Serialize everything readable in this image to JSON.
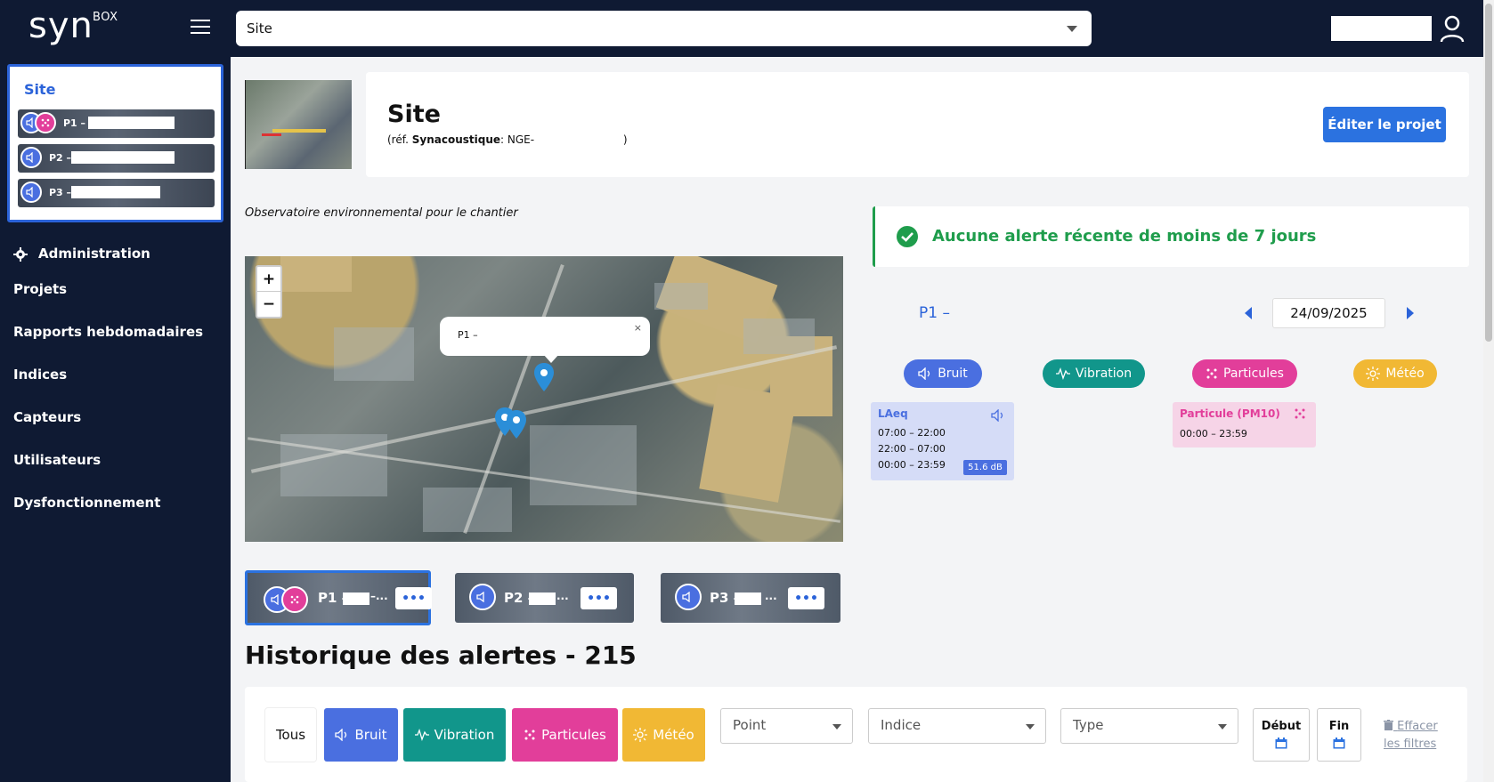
{
  "app": {
    "logo": "syn",
    "logo_sup": "BOX"
  },
  "topbar": {
    "site_select_value": "Site"
  },
  "sidebar": {
    "site_title": "Site",
    "points": [
      {
        "label": "P1 –"
      },
      {
        "label": "P2 –"
      },
      {
        "label": "P3 –"
      }
    ],
    "menu": [
      {
        "label": "Administration"
      },
      {
        "label": "Projets"
      },
      {
        "label": "Rapports hebdomadaires"
      },
      {
        "label": "Indices"
      },
      {
        "label": "Capteurs"
      },
      {
        "label": "Utilisateurs"
      },
      {
        "label": "Dysfonctionnement"
      }
    ]
  },
  "header": {
    "title": "Site",
    "ref_prefix": "(réf.",
    "ref_brand": "Synacoustique",
    "ref_value": ": NGE-",
    "ref_suffix": ")",
    "edit_button": "Éditer le projet"
  },
  "description": "Observatoire environnemental pour le chantier",
  "map": {
    "zoom_in": "+",
    "zoom_out": "−",
    "popup_text": "P1 –",
    "popup_close": "×"
  },
  "alert": {
    "text": "Aucune alerte récente de moins de 7 jours"
  },
  "point_panel": {
    "point_label": "P1 –",
    "date": "24/09/2025",
    "tabs": [
      {
        "label": "Bruit",
        "color": "#4a6fe0"
      },
      {
        "label": "Vibration",
        "color": "#11968b"
      },
      {
        "label": "Particules",
        "color": "#e23e9a"
      },
      {
        "label": "Météo",
        "color": "#f1b834"
      }
    ],
    "laeq": {
      "title": "LAeq",
      "rows": [
        "07:00  –  22:00",
        "22:00  –  07:00",
        "00:00  –  23:59"
      ],
      "badge": "51.6 dB"
    },
    "pm10": {
      "title": "Particule (PM10)",
      "row": "00:00  –  23:59"
    }
  },
  "point_cards": [
    {
      "label": "P1 –",
      "suffix": "–..."
    },
    {
      "label": "P2 –",
      "suffix": "..."
    },
    {
      "label": "P3 –",
      "suffix": "..."
    }
  ],
  "history": {
    "title": "Historique des alertes - 215",
    "filters": {
      "all": "Tous",
      "bruit": "Bruit",
      "vibration": "Vibration",
      "particules": "Particules",
      "meteo": "Météo",
      "point_placeholder": "Point",
      "indice_placeholder": "Indice",
      "type_placeholder": "Type",
      "debut": "Début",
      "fin": "Fin",
      "clear": "Effacer les filtres"
    }
  },
  "colors": {
    "nav_bg": "#0f1a33",
    "accent": "#2b63d9",
    "success": "#1f9d4c",
    "bruit": "#4a6fe0",
    "vibration": "#11968b",
    "particules": "#e23e9a",
    "meteo": "#f1b834"
  },
  "more_label": "•••"
}
